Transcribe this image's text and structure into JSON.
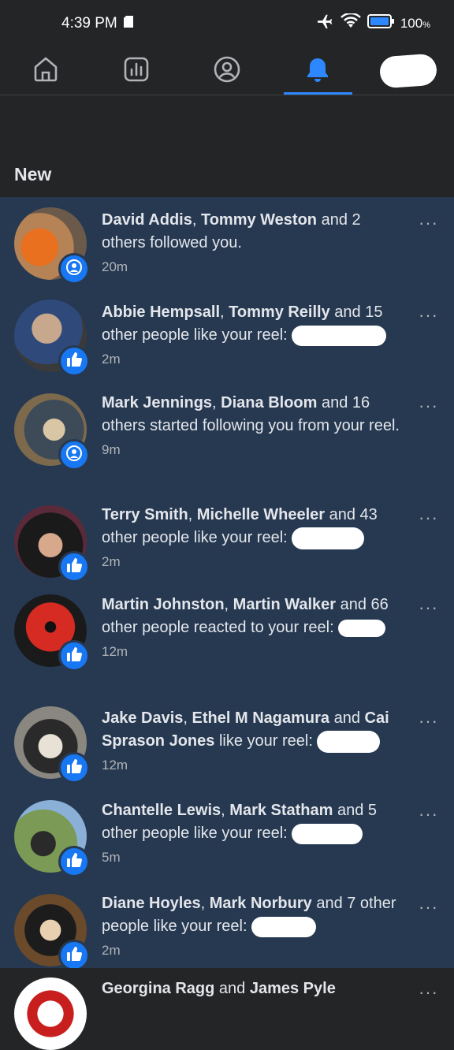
{
  "status": {
    "time": "4:39 PM",
    "battery_pct": "100",
    "battery_pct_symbol": "%"
  },
  "nav": {
    "tabs": [
      {
        "name": "home-tab",
        "icon": "home-icon"
      },
      {
        "name": "dashboard-tab",
        "icon": "bar-chart-icon"
      },
      {
        "name": "profile-tab",
        "icon": "profile-icon"
      },
      {
        "name": "notifications-tab",
        "icon": "bell-icon",
        "active": true
      },
      {
        "name": "account-tab",
        "icon": "redacted-avatar"
      }
    ],
    "accent": "#2d88ff"
  },
  "section": {
    "title": "New"
  },
  "notifications": [
    {
      "names": [
        "David Addis",
        "Tommy Weston"
      ],
      "join": ", ",
      "suffix": " and 2 others followed you.",
      "time": "20m",
      "badge": "follow"
    },
    {
      "names": [
        "Abbie Hempsall",
        "Tommy Reilly"
      ],
      "join": ", ",
      "suffix": " and 15 other people like your reel:",
      "time": "2m",
      "badge": "like"
    },
    {
      "names": [
        "Mark Jennings",
        "Diana Bloom"
      ],
      "join": ", ",
      "suffix": " and 16 others started following you from your reel.",
      "time": "9m",
      "badge": "follow"
    },
    {
      "names": [
        "Terry Smith",
        "Michelle Wheeler"
      ],
      "join": ", ",
      "suffix": " and 43 other people like your reel:",
      "time": "2m",
      "badge": "like"
    },
    {
      "names": [
        "Martin Johnston",
        "Martin Walker"
      ],
      "join": ", ",
      "suffix": " and 66 other people reacted to your reel:",
      "time": "12m",
      "badge": "like"
    },
    {
      "names": [
        "Jake Davis",
        "Ethel M Nagamura"
      ],
      "join": ", ",
      "name3": "Cai Sprason Jones",
      "suffix": " like your reel:",
      "time": "12m",
      "badge": "like"
    },
    {
      "names": [
        "Chantelle Lewis",
        "Mark Statham"
      ],
      "join": ", ",
      "suffix": " and 5 other people like your reel:",
      "time": "5m",
      "badge": "like"
    },
    {
      "names": [
        "Diane Hoyles",
        "Mark Norbury"
      ],
      "join": ", ",
      "suffix": " and 7 other people like your reel:",
      "time": "2m",
      "badge": "like"
    },
    {
      "names": [
        "Georgina Ragg"
      ],
      "join": "",
      "and_text": " and ",
      "name2": "James Pyle",
      "suffix": "",
      "time": "",
      "badge": "like"
    }
  ],
  "more_label": "···",
  "colors": {
    "unread_bg": "#263951",
    "page_bg": "#242526",
    "badge_blue": "#1877f2"
  }
}
